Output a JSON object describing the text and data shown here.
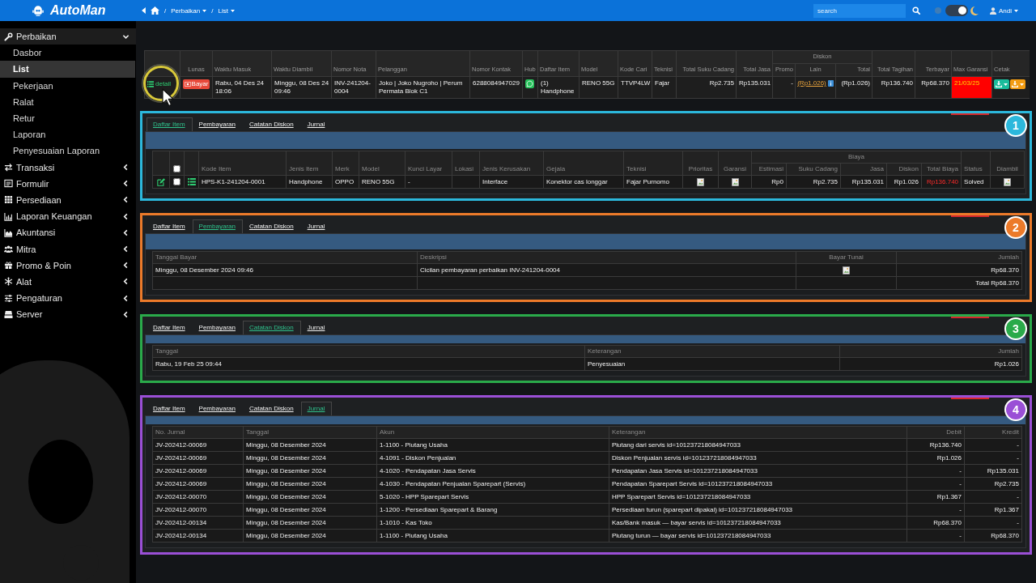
{
  "topbar": {
    "logo": "AutoMan",
    "breadcrumb": [
      {
        "kind": "home"
      },
      {
        "kind": "separator",
        "text": "/"
      },
      {
        "kind": "link",
        "text": "Perbaikan",
        "dropdown": true
      },
      {
        "kind": "separator",
        "text": "/"
      },
      {
        "kind": "link",
        "text": "List",
        "dropdown": true
      }
    ],
    "search": {
      "placeholder": "search"
    },
    "dark_mode": true,
    "user": {
      "name": "Andi",
      "dropdown": true
    }
  },
  "sidebar": {
    "items": [
      {
        "label": "Perbaikan",
        "expanded": true,
        "children": [
          {
            "label": "Dasbor",
            "selected": false
          },
          {
            "label": "List",
            "selected": true
          },
          {
            "label": "Pekerjaan",
            "selected": false
          },
          {
            "label": "Ralat",
            "selected": false
          },
          {
            "label": "Retur",
            "selected": false
          },
          {
            "label": "Laporan",
            "selected": false
          },
          {
            "label": "Penyesuaian Laporan",
            "selected": false
          }
        ]
      },
      {
        "label": "Transaksi",
        "expanded": false
      },
      {
        "label": "Formulir",
        "expanded": false
      },
      {
        "label": "Persediaan",
        "expanded": false
      },
      {
        "label": "Laporan Keuangan",
        "expanded": false
      },
      {
        "label": "Akuntansi",
        "expanded": false
      },
      {
        "label": "Mitra",
        "expanded": false
      },
      {
        "label": "Promo & Poin",
        "expanded": false
      },
      {
        "label": "Alat",
        "expanded": false
      },
      {
        "label": "Pengaturan",
        "expanded": false
      },
      {
        "label": "Server",
        "expanded": false
      }
    ]
  },
  "repair_table": {
    "columns": [
      {
        "kind": "blank"
      },
      {
        "label": "Lunas"
      },
      {
        "label": "Waktu Masuk"
      },
      {
        "label": "Waktu Diambil"
      },
      {
        "label": "Nomor Nota"
      },
      {
        "label": "Pelanggan"
      },
      {
        "label": "Nomor Kontak"
      },
      {
        "label": "Hub"
      },
      {
        "label": "Daftar Item"
      },
      {
        "label": "Model"
      },
      {
        "label": "Kode Cari"
      },
      {
        "label": "Teknisi"
      },
      {
        "label": "Total Suku Cadang"
      },
      {
        "label": "Total Jasa"
      },
      {
        "label": "Diskon",
        "colspan": 3,
        "children": [
          {
            "label": "Promo"
          },
          {
            "label": "Lain"
          },
          {
            "label": "Total"
          }
        ]
      },
      {
        "label": "Total Tagihan"
      },
      {
        "label": "Terbayar"
      },
      {
        "label": "Max Garansi"
      },
      {
        "label": "Cetak"
      }
    ],
    "rows": [
      {
        "cells": [
          {
            "kind": "detail-button",
            "text": "detail"
          },
          {
            "kind": "pay-button",
            "text": "Bayar"
          },
          {
            "kind": "text",
            "text": "Rabu, 04 Des 24 18:06"
          },
          {
            "kind": "text",
            "text": "Minggu, 08 Des 24 09:46"
          },
          {
            "kind": "text",
            "text": "INV-241204-0004"
          },
          {
            "kind": "text",
            "text": "Joko | Joko Nugroho | Perum Permata Blok C1"
          },
          {
            "kind": "text",
            "text": "6288084947029"
          },
          {
            "kind": "chat-icon"
          },
          {
            "kind": "text",
            "text": "(1) Handphone"
          },
          {
            "kind": "text",
            "text": "RENO 55G"
          },
          {
            "kind": "text",
            "text": "TTVP4LW"
          },
          {
            "kind": "text",
            "text": "Fajar"
          },
          {
            "kind": "number",
            "text": "Rp2.735"
          },
          {
            "kind": "number",
            "text": "Rp135.031"
          },
          {
            "kind": "number",
            "text": "-"
          },
          {
            "kind": "discount-link",
            "text": "(Rp1.026)"
          },
          {
            "kind": "number",
            "text": "(Rp1.026)"
          },
          {
            "kind": "number",
            "text": "Rp136.740"
          },
          {
            "kind": "number",
            "text": "Rp68.370"
          },
          {
            "kind": "alert-date",
            "text": "21/03/25"
          },
          {
            "kind": "print-buttons",
            "buttons": [
              {
                "color": "#1abc9c"
              },
              {
                "color": "#f39c12"
              }
            ]
          }
        ]
      }
    ]
  },
  "panels": [
    {
      "step_number": "1",
      "color": "#2cb8dc",
      "tabs": [
        {
          "label": "Daftar Item",
          "selected": true
        },
        {
          "label": "Pembayaran",
          "selected": false
        },
        {
          "label": "Catatan Diskon",
          "selected": false
        },
        {
          "label": "Jurnal",
          "selected": false
        }
      ],
      "table": {
        "columns": [
          {
            "kind": "blank"
          },
          {
            "kind": "checkbox",
            "checked": false
          },
          {
            "kind": "blank"
          },
          {
            "label": "Kode Item"
          },
          {
            "label": "Jenis Item"
          },
          {
            "label": "Merk"
          },
          {
            "label": "Model"
          },
          {
            "label": "Kunci Layar"
          },
          {
            "label": "Lokasi"
          },
          {
            "label": "Jenis Kerusakan"
          },
          {
            "label": "Gejala"
          },
          {
            "label": "Teknisi"
          },
          {
            "label": "Prioritas"
          },
          {
            "label": "Garansi"
          },
          {
            "label": "Biaya",
            "colspan": 5,
            "children": [
              {
                "label": "Estimasi"
              },
              {
                "label": "Suku Cadang"
              },
              {
                "label": "Jasa"
              },
              {
                "label": "Diskon"
              },
              {
                "label": "Total Biaya"
              }
            ]
          },
          {
            "label": "Status"
          },
          {
            "label": "Diambil"
          }
        ],
        "rows": [
          {
            "cells": [
              {
                "kind": "edit-icon"
              },
              {
                "kind": "checkbox",
                "checked": false
              },
              {
                "kind": "list-icon"
              },
              {
                "kind": "text",
                "text": "HPS-K1-241204-0001"
              },
              {
                "kind": "text",
                "text": "Handphone"
              },
              {
                "kind": "text",
                "text": "OPPO"
              },
              {
                "kind": "text",
                "text": "RENO 55G"
              },
              {
                "kind": "text",
                "text": "-"
              },
              {
                "kind": "empty"
              },
              {
                "kind": "text",
                "text": "Interface"
              },
              {
                "kind": "text",
                "text": "Konektor cas longgar"
              },
              {
                "kind": "text",
                "text": "Fajar Purnomo"
              },
              {
                "kind": "broken-image"
              },
              {
                "kind": "broken-image"
              },
              {
                "kind": "number",
                "text": "Rp0"
              },
              {
                "kind": "number",
                "text": "Rp2.735"
              },
              {
                "kind": "number",
                "text": "Rp135.031"
              },
              {
                "kind": "number",
                "text": "Rp1.026"
              },
              {
                "kind": "alert-number",
                "text": "Rp136.740"
              },
              {
                "kind": "text",
                "text": "Solved"
              },
              {
                "kind": "broken-image"
              }
            ]
          }
        ]
      }
    },
    {
      "step_number": "2",
      "color": "#ec7a2a",
      "tabs": [
        {
          "label": "Daftar Item",
          "selected": false
        },
        {
          "label": "Pembayaran",
          "selected": true
        },
        {
          "label": "Catatan Diskon",
          "selected": false
        },
        {
          "label": "Jurnal",
          "selected": false
        }
      ],
      "table": {
        "columns": [
          {
            "label": "Tanggal Bayar"
          },
          {
            "label": "Deskripsi"
          },
          {
            "label": "Bayar Tunai"
          },
          {
            "label": "Jumlah"
          }
        ],
        "rows": [
          {
            "cells": [
              {
                "kind": "text",
                "text": "Minggu, 08 Desember 2024 09:46"
              },
              {
                "kind": "text",
                "text": "Cicilan pembayaran perbaikan INV-241204-0004"
              },
              {
                "kind": "broken-image"
              },
              {
                "kind": "number",
                "text": "Rp68.370"
              }
            ]
          },
          {
            "cells": [
              {
                "kind": "empty"
              },
              {
                "kind": "empty"
              },
              {
                "kind": "empty"
              },
              {
                "kind": "number",
                "text": "Total Rp68.370"
              }
            ]
          }
        ]
      }
    },
    {
      "step_number": "3",
      "color": "#2aaa4a",
      "tabs": [
        {
          "label": "Daftar Item",
          "selected": false
        },
        {
          "label": "Pembayaran",
          "selected": false
        },
        {
          "label": "Catatan Diskon",
          "selected": true
        },
        {
          "label": "Jurnal",
          "selected": false
        }
      ],
      "table": {
        "columns": [
          {
            "label": "Tanggal"
          },
          {
            "label": "Keterangan"
          },
          {
            "label": "Jumlah"
          }
        ],
        "rows": [
          {
            "cells": [
              {
                "kind": "text",
                "text": "Rabu, 19 Feb 25 09:44"
              },
              {
                "kind": "text",
                "text": "Penyesuaian"
              },
              {
                "kind": "number",
                "text": "Rp1.026"
              }
            ]
          }
        ]
      }
    },
    {
      "step_number": "4",
      "color": "#9a4fd6",
      "tabs": [
        {
          "label": "Daftar Item",
          "selected": false
        },
        {
          "label": "Pembayaran",
          "selected": false
        },
        {
          "label": "Catatan Diskon",
          "selected": false
        },
        {
          "label": "Jurnal",
          "selected": true
        }
      ],
      "table": {
        "columns": [
          {
            "label": "No. Jurnal"
          },
          {
            "label": "Tanggal"
          },
          {
            "label": "Akun"
          },
          {
            "label": "Keterangan"
          },
          {
            "label": "Debit"
          },
          {
            "label": "Kredit"
          }
        ],
        "rows": [
          {
            "cells": [
              {
                "kind": "text",
                "text": "JV-202412-00069"
              },
              {
                "kind": "text",
                "text": "Minggu, 08 Desember 2024"
              },
              {
                "kind": "text",
                "text": "1-1100 - Piutang Usaha"
              },
              {
                "kind": "text",
                "text": "Piutang dari servis id=101237218084947033"
              },
              {
                "kind": "number",
                "text": "Rp136.740"
              },
              {
                "kind": "number",
                "text": "-"
              }
            ]
          },
          {
            "cells": [
              {
                "kind": "text",
                "text": "JV-202412-00069"
              },
              {
                "kind": "text",
                "text": "Minggu, 08 Desember 2024"
              },
              {
                "kind": "text",
                "text": "4-1091 - Diskon Penjualan"
              },
              {
                "kind": "text",
                "text": "Diskon Penjualan servis id=101237218084947033"
              },
              {
                "kind": "number",
                "text": "Rp1.026"
              },
              {
                "kind": "number",
                "text": "-"
              }
            ]
          },
          {
            "cells": [
              {
                "kind": "text",
                "text": "JV-202412-00069"
              },
              {
                "kind": "text",
                "text": "Minggu, 08 Desember 2024"
              },
              {
                "kind": "text",
                "text": "4-1020 - Pendapatan Jasa Servis"
              },
              {
                "kind": "text",
                "text": "Pendapatan Jasa Servis id=101237218084947033"
              },
              {
                "kind": "number",
                "text": "-"
              },
              {
                "kind": "number",
                "text": "Rp135.031"
              }
            ]
          },
          {
            "cells": [
              {
                "kind": "text",
                "text": "JV-202412-00069"
              },
              {
                "kind": "text",
                "text": "Minggu, 08 Desember 2024"
              },
              {
                "kind": "text",
                "text": "4-1030 - Pendapatan Penjualan Sparepart (Servis)"
              },
              {
                "kind": "text",
                "text": "Pendapatan Sparepart Servis id=101237218084947033"
              },
              {
                "kind": "number",
                "text": "-"
              },
              {
                "kind": "number",
                "text": "Rp2.735"
              }
            ]
          },
          {
            "cells": [
              {
                "kind": "text",
                "text": "JV-202412-00070"
              },
              {
                "kind": "text",
                "text": "Minggu, 08 Desember 2024"
              },
              {
                "kind": "text",
                "text": "5-1020 - HPP Sparepart Servis"
              },
              {
                "kind": "text",
                "text": "HPP Sparepart Servis id=101237218084947033"
              },
              {
                "kind": "number",
                "text": "Rp1.367"
              },
              {
                "kind": "number",
                "text": "-"
              }
            ]
          },
          {
            "cells": [
              {
                "kind": "text",
                "text": "JV-202412-00070"
              },
              {
                "kind": "text",
                "text": "Minggu, 08 Desember 2024"
              },
              {
                "kind": "text",
                "text": "1-1200 - Persediaan Sparepart & Barang"
              },
              {
                "kind": "text",
                "text": "Persediaan turun (sparepart dipakai) id=101237218084947033"
              },
              {
                "kind": "number",
                "text": "-"
              },
              {
                "kind": "number",
                "text": "Rp1.367"
              }
            ]
          },
          {
            "cells": [
              {
                "kind": "text",
                "text": "JV-202412-00134"
              },
              {
                "kind": "text",
                "text": "Minggu, 08 Desember 2024"
              },
              {
                "kind": "text",
                "text": "1-1010 - Kas Toko"
              },
              {
                "kind": "text",
                "text": "Kas/Bank masuk — bayar servis id=101237218084947033"
              },
              {
                "kind": "number",
                "text": "Rp68.370"
              },
              {
                "kind": "number",
                "text": "-"
              }
            ]
          },
          {
            "cells": [
              {
                "kind": "text",
                "text": "JV-202412-00134"
              },
              {
                "kind": "text",
                "text": "Minggu, 08 Desember 2024"
              },
              {
                "kind": "text",
                "text": "1-1100 - Piutang Usaha"
              },
              {
                "kind": "text",
                "text": "Piutang turun — bayar servis id=101237218084947033"
              },
              {
                "kind": "number",
                "text": "-"
              },
              {
                "kind": "number",
                "text": "Rp68.370"
              }
            ]
          }
        ]
      }
    }
  ]
}
